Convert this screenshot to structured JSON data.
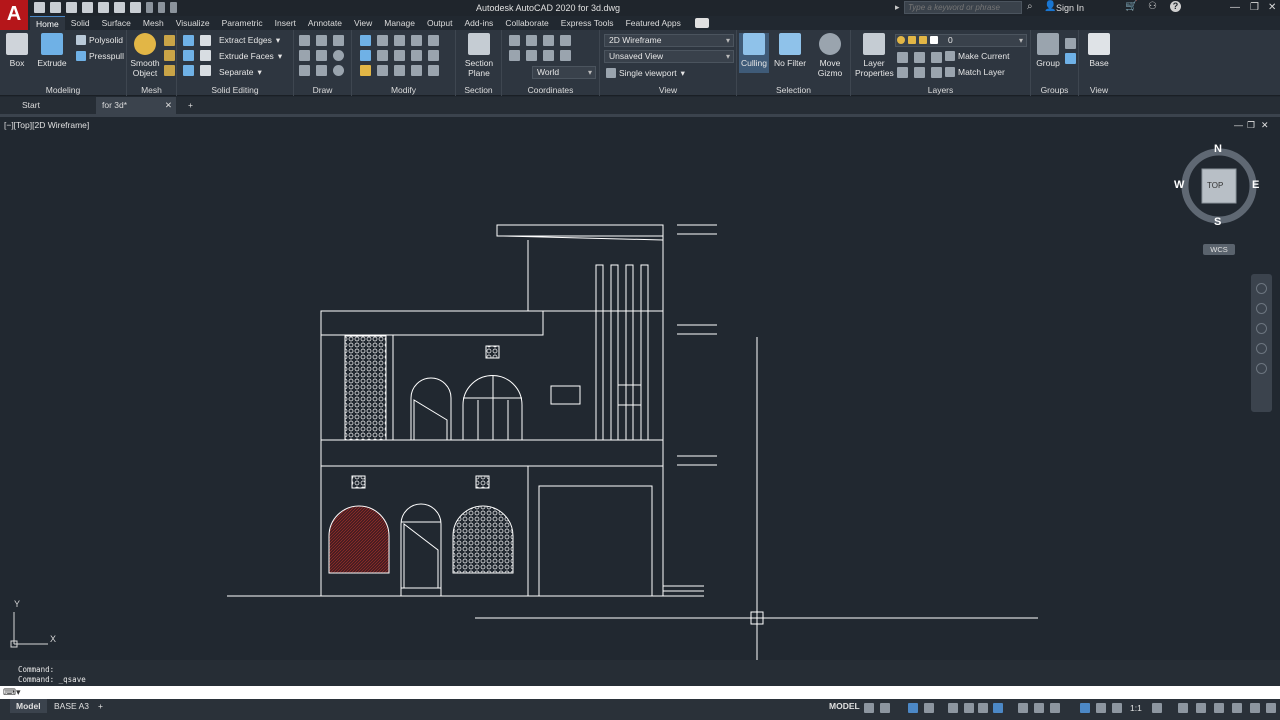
{
  "window": {
    "title": "Autodesk AutoCAD 2020    for 3d.dwg",
    "search_placeholder": "Type a keyword or phrase",
    "sign_in": "Sign In"
  },
  "ribbon_tabs": [
    "Home",
    "Solid",
    "Surface",
    "Mesh",
    "Visualize",
    "Parametric",
    "Insert",
    "Annotate",
    "View",
    "Manage",
    "Output",
    "Add-ins",
    "Collaborate",
    "Express Tools",
    "Featured Apps"
  ],
  "ribbon": {
    "modeling": {
      "label": "Modeling",
      "box": "Box",
      "extrude": "Extrude",
      "polysolid": "Polysolid",
      "presspull": "Presspull"
    },
    "mesh": {
      "label": "Mesh",
      "smooth_object": "Smooth Object"
    },
    "solid_editing": {
      "label": "Solid Editing",
      "extract_edges": "Extract Edges",
      "extrude_faces": "Extrude Faces",
      "separate": "Separate"
    },
    "draw": {
      "label": "Draw"
    },
    "modify": {
      "label": "Modify"
    },
    "section": {
      "label": "Section",
      "section_plane": "Section Plane"
    },
    "coordinates": {
      "label": "Coordinates",
      "world": "World"
    },
    "view": {
      "label": "View",
      "visual_style": "2D Wireframe",
      "named_view": "Unsaved View",
      "viewport": "Single viewport"
    },
    "selection": {
      "label": "Selection",
      "culling": "Culling",
      "no_filter": "No Filter",
      "move_gizmo": "Move Gizmo"
    },
    "layers": {
      "label": "Layers",
      "layer_properties": "Layer Properties",
      "current_layer": "0",
      "make_current": "Make Current",
      "match_layer": "Match Layer"
    },
    "groups": {
      "label": "Groups",
      "group": "Group"
    },
    "view2": {
      "label": "View",
      "base": "Base"
    }
  },
  "doc_tabs": [
    "Start",
    "for 3d*"
  ],
  "viewport": {
    "label": "[−][Top][2D Wireframe]",
    "viewcube": {
      "north": "N",
      "south": "S",
      "east": "E",
      "west": "W",
      "face": "TOP",
      "wcs": "WCS"
    },
    "ucs": {
      "x": "X",
      "y": "Y"
    }
  },
  "command": {
    "history": [
      "Command:",
      "Command: _qsave"
    ],
    "input_value": ""
  },
  "status": {
    "layout_tabs": [
      "Model",
      "BASE A3"
    ],
    "space": "MODEL",
    "scale": "1:1"
  },
  "colors": {
    "background": "#212830",
    "ribbon": "#2e3640",
    "accent": "#4c88c6",
    "brand": "#b5161a",
    "drawing_line": "#ffffff",
    "hatch": "#c0392b"
  }
}
